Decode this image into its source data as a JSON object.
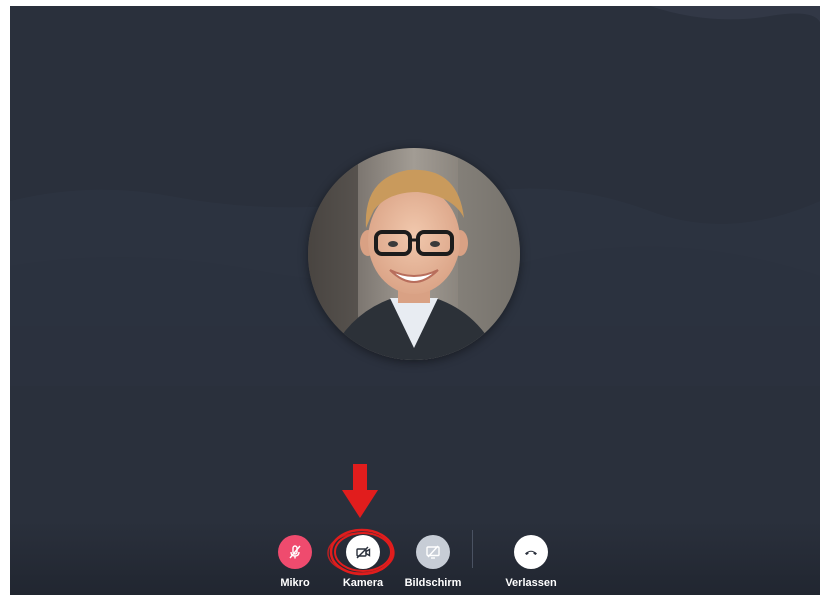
{
  "controls": {
    "mic": {
      "label": "Mikro",
      "icon": "microphone-off-icon",
      "color": "#ef4b6e"
    },
    "camera": {
      "label": "Kamera",
      "icon": "camera-off-icon",
      "color": "#ffffff"
    },
    "screen": {
      "label": "Bildschirm",
      "icon": "screen-share-off-icon",
      "color": "#c7cdd6"
    },
    "leave": {
      "label": "Verlassen",
      "icon": "hang-up-icon",
      "color": "#ffffff"
    }
  },
  "annotation": {
    "highlight_color": "#e11d1d"
  },
  "colors": {
    "background": "#2a303c"
  }
}
